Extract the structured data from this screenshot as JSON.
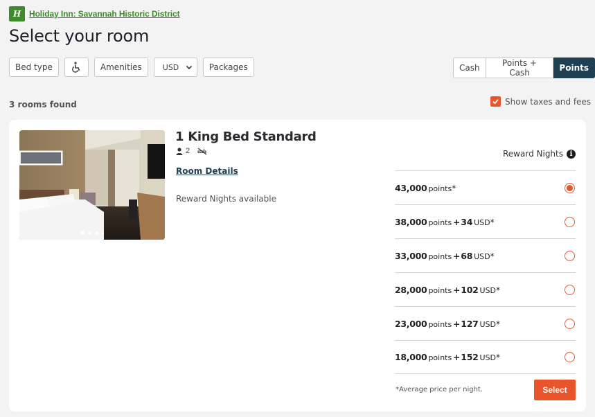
{
  "header": {
    "brand_logo_glyph": "H",
    "hotel_name": "Holiday Inn: Savannah Historic District",
    "page_title": "Select your room"
  },
  "filters": {
    "bed_type": "Bed type",
    "accessibility_icon": "wheelchair-icon",
    "amenities": "Amenities",
    "currency": "USD",
    "packages": "Packages"
  },
  "payment_toggle": {
    "options": [
      "Cash",
      "Points + Cash",
      "Points"
    ],
    "selected": "Points"
  },
  "results": {
    "count_label": "3 rooms found",
    "show_taxes_label": "Show taxes and fees",
    "show_taxes_checked": true
  },
  "room": {
    "title": "1 King Bed Standard",
    "guests": "2",
    "guest_icon": "person-icon",
    "smoking_icon": "no-smoking-icon",
    "details_link": "Room Details",
    "availability": "Reward Nights available",
    "photo_count": 4,
    "photo_index": 1,
    "rates_header": "Reward Nights",
    "rates": [
      {
        "points": "43,000",
        "points_label": "points",
        "plus": "",
        "cash": "",
        "currency": "",
        "asterisk": "*",
        "selected": true
      },
      {
        "points": "38,000",
        "points_label": "points",
        "plus": "+",
        "cash": "34",
        "currency": "USD",
        "asterisk": "*",
        "selected": false
      },
      {
        "points": "33,000",
        "points_label": "points",
        "plus": "+",
        "cash": "68",
        "currency": "USD",
        "asterisk": "*",
        "selected": false
      },
      {
        "points": "28,000",
        "points_label": "points",
        "plus": "+",
        "cash": "102",
        "currency": "USD",
        "asterisk": "*",
        "selected": false
      },
      {
        "points": "23,000",
        "points_label": "points",
        "plus": "+",
        "cash": "127",
        "currency": "USD",
        "asterisk": "*",
        "selected": false
      },
      {
        "points": "18,000",
        "points_label": "points",
        "plus": "+",
        "cash": "152",
        "currency": "USD",
        "asterisk": "*",
        "selected": false
      }
    ],
    "footnote": "*Average price per night.",
    "select_label": "Select"
  },
  "colors": {
    "brand_green": "#3f8a2a",
    "accent_orange": "#e8552b",
    "active_navy": "#1f3f52"
  }
}
